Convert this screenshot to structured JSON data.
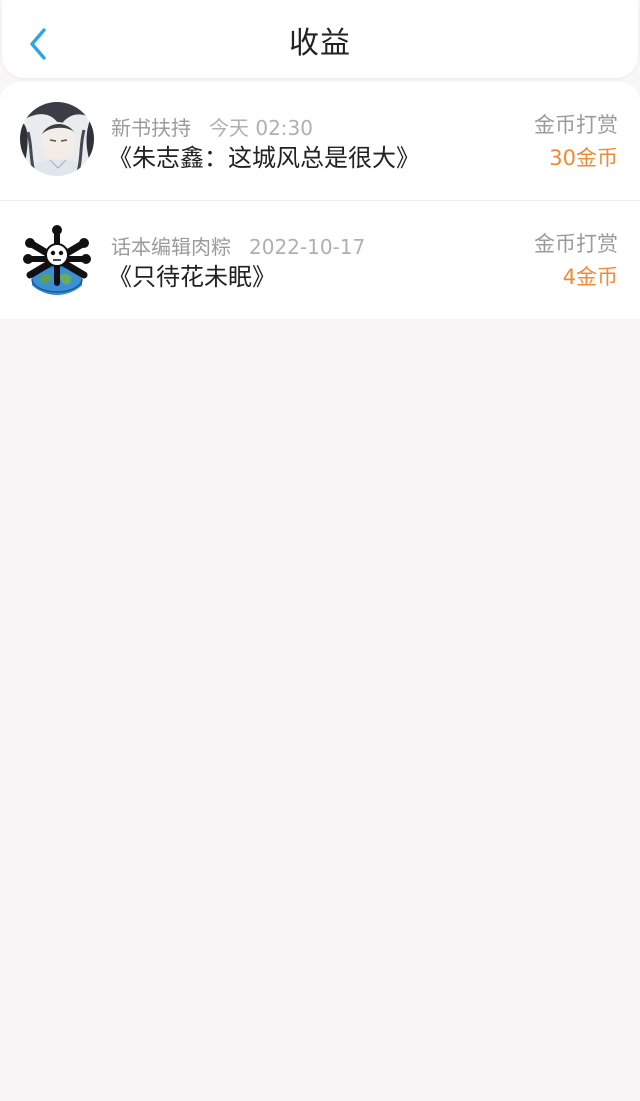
{
  "header": {
    "title": "收益"
  },
  "colors": {
    "accent": "#2ba5e6",
    "amount": "#f08a38",
    "background": "#f8f6f7"
  },
  "items": [
    {
      "user": "新书扶持",
      "time": "今天 02:30",
      "book": "《朱志鑫：这城风总是很大》",
      "type": "金币打赏",
      "amount": "30金币",
      "avatar_icon": "anime-character-avatar"
    },
    {
      "user": "话本编辑肉粽",
      "time": "2022-10-17",
      "book": "《只待花未眠》",
      "type": "金币打赏",
      "amount": "4金币",
      "avatar_icon": "skull-earth-avatar"
    }
  ]
}
